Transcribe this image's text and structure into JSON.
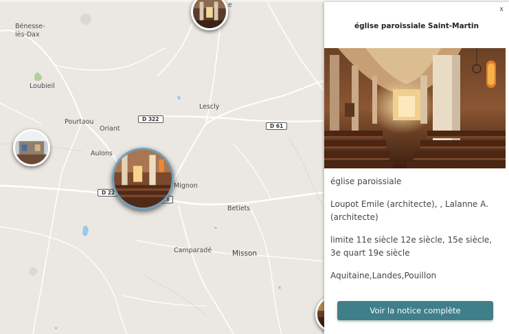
{
  "map": {
    "places": [
      {
        "id": "benesse",
        "label": "Bénesse-\nlès-Dax"
      },
      {
        "id": "loubieil",
        "label": "Loubieil"
      },
      {
        "id": "pourtaou",
        "label": "Pourtaou"
      },
      {
        "id": "oriant",
        "label": "Oriant"
      },
      {
        "id": "lescly",
        "label": "Lescly"
      },
      {
        "id": "aulons",
        "label": "Aulons"
      },
      {
        "id": "mignon",
        "label": "Mignon"
      },
      {
        "id": "betiets",
        "label": "Betiets"
      },
      {
        "id": "camparade",
        "label": "Camparadé"
      },
      {
        "id": "misson",
        "label": "Misson"
      },
      {
        "id": "partial-e",
        "label": "e"
      }
    ],
    "roads": [
      {
        "id": "d322",
        "label": "D 322"
      },
      {
        "id": "d61",
        "label": "D 61"
      },
      {
        "id": "d22",
        "label": "D 22"
      },
      {
        "id": "d13",
        "label": "13"
      }
    ],
    "markers": [
      {
        "id": "top",
        "icon": "church-photo-marker"
      },
      {
        "id": "left",
        "icon": "church-photo-marker"
      },
      {
        "id": "selected",
        "icon": "church-photo-marker"
      },
      {
        "id": "bottom-right",
        "icon": "church-photo-marker"
      }
    ]
  },
  "panel": {
    "close_label": "x",
    "title": "église paroissiale Saint-Martin",
    "photo_icon": "church-interior-photo",
    "type": "église paroissiale",
    "authors": "Loupot Emile (architecte), , Lalanne A. (architecte)",
    "period": "limite 11e siècle 12e siècle, 15e siècle, 3e quart 19e siècle",
    "location": "Aquitaine,Landes,Pouillon",
    "cta_label": "Voir la notice complète"
  },
  "colors": {
    "map_background": "#ebe8e3",
    "button": "#3f7f8a",
    "selected_ring": "#6c9fbf"
  }
}
